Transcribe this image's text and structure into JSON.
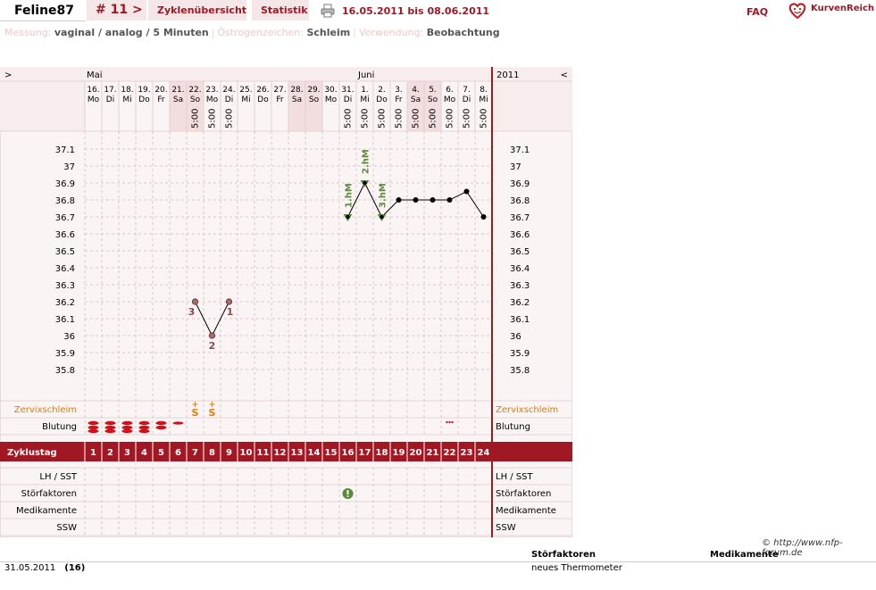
{
  "header": {
    "user_name": "Feline87",
    "cycle_label": "# 11 >",
    "tab_overview": "Zyklenübersicht",
    "tab_stats": "Statistik",
    "date_range": "16.05.2011 bis 08.06.2011",
    "faq": "FAQ",
    "brand": "KurvenReich",
    "printer_icon": "printer-icon",
    "brand_icon": "heart-face-icon"
  },
  "info": {
    "measure_label": "Messung:",
    "measure_value": "vaginal / analog / 5 Minuten",
    "estrogen_label": "Östrogenzeichen:",
    "estrogen_value": "Schleim",
    "usage_label": "Verwendung:",
    "usage_value": "Beobachtung"
  },
  "chart_data": {
    "type": "line",
    "nav_prev": ">",
    "nav_next": "<",
    "year": "2011",
    "months": [
      {
        "label": "Mai",
        "day_index": 0
      },
      {
        "label": "Juni",
        "day_index": 16
      }
    ],
    "days": [
      {
        "date": "16.",
        "wd": "Mo",
        "time": "",
        "weekend": false
      },
      {
        "date": "17.",
        "wd": "Di",
        "time": "",
        "weekend": false
      },
      {
        "date": "18.",
        "wd": "Mi",
        "time": "",
        "weekend": false
      },
      {
        "date": "19.",
        "wd": "Do",
        "time": "",
        "weekend": false
      },
      {
        "date": "20.",
        "wd": "Fr",
        "time": "",
        "weekend": false
      },
      {
        "date": "21.",
        "wd": "Sa",
        "time": "",
        "weekend": true
      },
      {
        "date": "22.",
        "wd": "So",
        "time": "5:00",
        "weekend": true
      },
      {
        "date": "23.",
        "wd": "Mo",
        "time": "5:00",
        "weekend": false
      },
      {
        "date": "24.",
        "wd": "Di",
        "time": "5:00",
        "weekend": false
      },
      {
        "date": "25.",
        "wd": "Mi",
        "time": "",
        "weekend": false
      },
      {
        "date": "26.",
        "wd": "Do",
        "time": "",
        "weekend": false
      },
      {
        "date": "27.",
        "wd": "Fr",
        "time": "",
        "weekend": false
      },
      {
        "date": "28.",
        "wd": "Sa",
        "time": "",
        "weekend": true
      },
      {
        "date": "29.",
        "wd": "So",
        "time": "",
        "weekend": true
      },
      {
        "date": "30.",
        "wd": "Mo",
        "time": "",
        "weekend": false
      },
      {
        "date": "31.",
        "wd": "Di",
        "time": "5:00",
        "weekend": false
      },
      {
        "date": "1.",
        "wd": "Mi",
        "time": "5:00",
        "weekend": false
      },
      {
        "date": "2.",
        "wd": "Do",
        "time": "5:00",
        "weekend": false
      },
      {
        "date": "3.",
        "wd": "Fr",
        "time": "5:00",
        "weekend": false
      },
      {
        "date": "4.",
        "wd": "Sa",
        "time": "5:00",
        "weekend": true
      },
      {
        "date": "5.",
        "wd": "So",
        "time": "5:00",
        "weekend": true
      },
      {
        "date": "6.",
        "wd": "Mo",
        "time": "5:00",
        "weekend": false
      },
      {
        "date": "7.",
        "wd": "Di",
        "time": "5:00",
        "weekend": false
      },
      {
        "date": "8.",
        "wd": "Mi",
        "time": "5:00",
        "weekend": false
      }
    ],
    "y_ticks": [
      "37.1",
      "37",
      "36.9",
      "36.8",
      "36.7",
      "36.6",
      "36.5",
      "36.4",
      "36.3",
      "36.2",
      "36.1",
      "36",
      "35.9",
      "35.8"
    ],
    "ylim": [
      35.75,
      37.15
    ],
    "series": [
      {
        "points": [
          {
            "cycle_day": 7,
            "temp": 36.2,
            "label": "3"
          },
          {
            "cycle_day": 8,
            "temp": 36.0,
            "label": "2"
          },
          {
            "cycle_day": 9,
            "temp": 36.2,
            "label": "1"
          }
        ],
        "color": "#8b4a4a",
        "role": "low-six"
      },
      {
        "points": [
          {
            "cycle_day": 16,
            "temp": 36.7,
            "label": "1.hM"
          },
          {
            "cycle_day": 17,
            "temp": 36.9,
            "label": "2.hM"
          },
          {
            "cycle_day": 18,
            "temp": 36.7,
            "label": "3.hM"
          },
          {
            "cycle_day": 19,
            "temp": 36.8,
            "label": ""
          },
          {
            "cycle_day": 20,
            "temp": 36.8,
            "label": ""
          },
          {
            "cycle_day": 21,
            "temp": 36.8,
            "label": ""
          },
          {
            "cycle_day": 22,
            "temp": 36.8,
            "label": ""
          },
          {
            "cycle_day": 23,
            "temp": 36.85,
            "label": ""
          },
          {
            "cycle_day": 24,
            "temp": 36.7,
            "label": ""
          }
        ],
        "color": "#000000",
        "marker_color": "#5a8a3a",
        "role": "high"
      }
    ],
    "rows": {
      "cervix": "Zervixschleim",
      "bleeding": "Blutung",
      "cycle_day": "Zyklustag",
      "lh": "LH / SST",
      "disturb": "Störfaktoren",
      "meds": "Medikamente",
      "ssw": "SSW"
    },
    "cervix_marks": [
      {
        "cycle_day": 7,
        "symbol": "S"
      },
      {
        "cycle_day": 8,
        "symbol": "S"
      }
    ],
    "bleeding": [
      {
        "cycle_day": 1,
        "level": 3
      },
      {
        "cycle_day": 2,
        "level": 3
      },
      {
        "cycle_day": 3,
        "level": 3
      },
      {
        "cycle_day": 4,
        "level": 3
      },
      {
        "cycle_day": 5,
        "level": 2
      },
      {
        "cycle_day": 6,
        "level": 1
      },
      {
        "cycle_day": 22,
        "level": 0.5
      }
    ],
    "disturbance_days": [
      16
    ],
    "colors": {
      "accent": "#a11825",
      "orange": "#e07b00",
      "green": "#5a8a3a",
      "weekend": "#f2dede",
      "grid": "#dcc8c8"
    }
  },
  "footer": {
    "copyright": "© http://www.nfp-forum.de",
    "col_disturb": "Störfaktoren",
    "col_meds": "Medikamente",
    "entry_date": "31.05.2011",
    "entry_day": "(16)",
    "entry_text": "neues Thermometer"
  }
}
